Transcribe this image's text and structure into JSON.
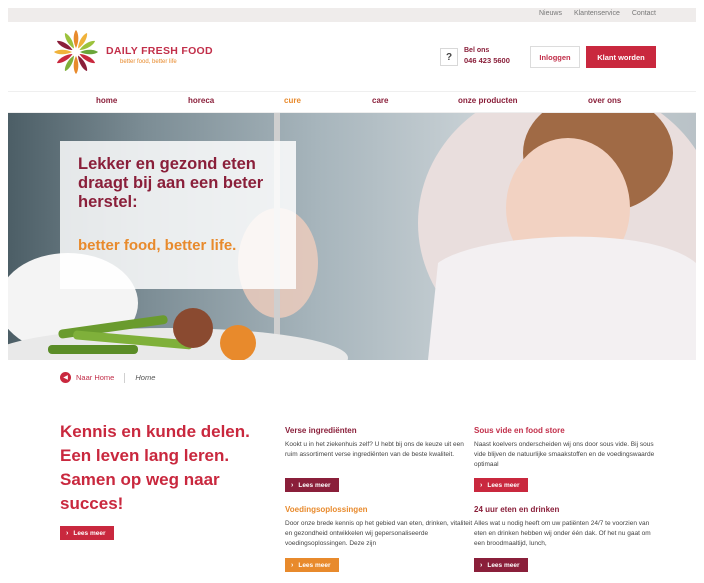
{
  "topbar": {
    "links": [
      "Nieuws",
      "Klantenservice",
      "Contact"
    ]
  },
  "header": {
    "brand": "DAILY FRESH FOOD",
    "tagline": "better food, better life",
    "help_icon": "question-icon",
    "call_label": "Bel ons",
    "call_number": "046 423 5600",
    "login_label": "Inloggen",
    "signup_label": "Klant worden"
  },
  "nav": {
    "items": [
      {
        "label": "home"
      },
      {
        "label": "horeca"
      },
      {
        "label": "cure"
      },
      {
        "label": "care"
      },
      {
        "label": "onze producten"
      },
      {
        "label": "over ons"
      }
    ],
    "active_index": 2
  },
  "hero": {
    "title": "Lekker en gezond eten draagt bij aan een beter herstel:",
    "subtitle": "better food, better life."
  },
  "breadcrumb": {
    "home_icon": "home-circle-icon",
    "home_label": "Naar Home",
    "current": "Home"
  },
  "intro": {
    "heading": "Kennis en kunde delen. Een leven lang leren. Samen op weg naar succes!",
    "button": "Lees meer"
  },
  "cards": [
    {
      "title": "Verse ingrediënten",
      "text": "Kookt u in het ziekenhuis zelf? U hebt bij ons de keuze uit een ruim assortiment verse ingrediënten van de beste kwaliteit.",
      "button": "Lees meer"
    },
    {
      "title": "Sous vide en food store",
      "text": "Naast koelvers onderscheiden wij ons door sous vide. Bij sous vide blijven de natuurlijke smaakstoffen en de voedingswaarde optimaal",
      "button": "Lees meer"
    },
    {
      "title": "Voedingsoplossingen",
      "text": "Door onze brede kennis op het gebied van eten, drinken, vitaliteit en gezondheid ontwikkelen wij gepersonaliseerde voedingsoplossingen. Deze zijn",
      "button": "Lees meer"
    },
    {
      "title": "24 uur eten en drinken",
      "text": "Alles wat u nodig heeft om uw patiënten 24/7 te voorzien van eten en drinken hebben wij onder één dak. Of het nu gaat om een broodmaaltijd, lunch,",
      "button": "Lees meer"
    }
  ],
  "colors": {
    "maroon": "#8a1f3a",
    "red": "#c9283e",
    "orange": "#e88a2c"
  }
}
